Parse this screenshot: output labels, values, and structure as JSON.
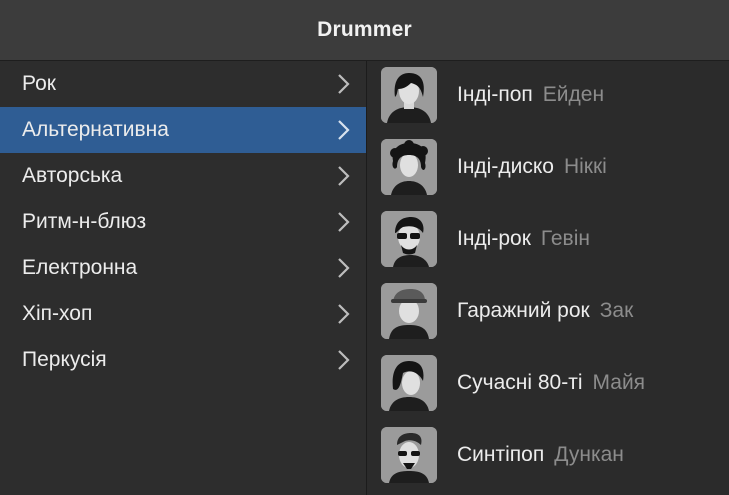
{
  "window": {
    "title": "Drummer"
  },
  "genres": [
    {
      "label": "Рок",
      "selected": false
    },
    {
      "label": "Альтернативна",
      "selected": true
    },
    {
      "label": "Авторська",
      "selected": false
    },
    {
      "label": "Ритм-н-блюз",
      "selected": false
    },
    {
      "label": "Електронна",
      "selected": false
    },
    {
      "label": "Хіп-хоп",
      "selected": false
    },
    {
      "label": "Перкусія",
      "selected": false
    }
  ],
  "drummers": [
    {
      "style": "Інді-поп",
      "name": "Ейден",
      "icon": "drummer-avatar-aiden-icon"
    },
    {
      "style": "Інді-диско",
      "name": "Ніккі",
      "icon": "drummer-avatar-nikki-icon"
    },
    {
      "style": "Інді-рок",
      "name": "Гевін",
      "icon": "drummer-avatar-gavin-icon"
    },
    {
      "style": "Гаражний рок",
      "name": "Зак",
      "icon": "drummer-avatar-zak-icon"
    },
    {
      "style": "Сучасні 80-ті",
      "name": "Майя",
      "icon": "drummer-avatar-maya-icon"
    },
    {
      "style": "Синтіпоп",
      "name": "Дункан",
      "icon": "drummer-avatar-duncan-icon"
    }
  ],
  "colors": {
    "selection": "#2f5d94",
    "titlebar": "#3c3c3c",
    "secondary_text": "#8c8c8c"
  }
}
